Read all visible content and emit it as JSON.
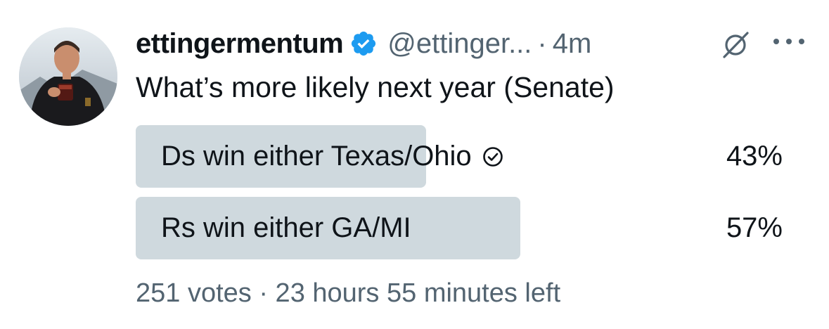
{
  "tweet": {
    "display_name": "ettingermentum",
    "handle": "@ettinger...",
    "separator": "·",
    "time": "4m",
    "verified_icon": "verified-badge-icon",
    "grok_icon": "grok-slash-icon",
    "more_icon": "more-dots-icon",
    "text": "What’s more likely next year (Senate)"
  },
  "poll": {
    "options": [
      {
        "label": "Ds win either Texas/Ohio",
        "percent": "43%",
        "fraction": 0.43,
        "selected": true
      },
      {
        "label": "Rs win either GA/MI",
        "percent": "57%",
        "fraction": 0.57,
        "selected": false
      }
    ],
    "footer": "251 votes · 23 hours 55 minutes left"
  },
  "colors": {
    "bar": "#cfd9de",
    "secondary_text": "#536471",
    "verified": "#1d9bf0"
  }
}
